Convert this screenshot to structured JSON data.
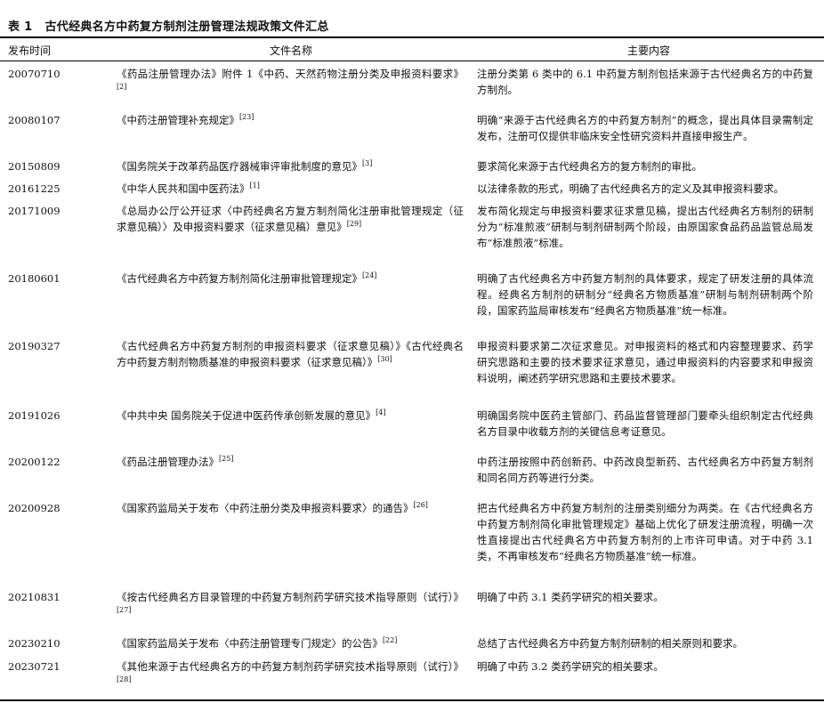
{
  "table": {
    "label": "表 1",
    "title": "古代经典名方中药复方制剂注册管理法规政策文件汇总",
    "headers": [
      "发布时间",
      "文件名称",
      "主要内容"
    ],
    "rows": [
      {
        "date": "20070710",
        "name": "《药品注册管理办法》附件 1《中药、天然药物注册分类及申报资料要求》",
        "ref": "[2]",
        "content": "注册分类第 6 类中的 6.1 中药复方制剂包括来源于古代经典名方的中药复方制剂。"
      },
      {
        "date": "20080107",
        "name": "《中药注册管理补充规定》",
        "ref": "[23]",
        "content": "明确“来源于古代经典名方的中药复方制剂”的概念，提出具体目录需制定发布，注册可仅提供非临床安全性研究资料并直接申报生产。"
      },
      {
        "date": "20150809",
        "name": "《国务院关于改革药品医疗器械审评审批制度的意见》",
        "ref": "[3]",
        "content": "要求简化来源于古代经典名方的复方制剂的审批。"
      },
      {
        "date": "20161225",
        "name": "《中华人民共和国中医药法》",
        "ref": "[1]",
        "content": "以法律条款的形式，明确了古代经典名方的定义及其申报资料要求。"
      },
      {
        "date": "20171009",
        "name": "《总局办公厅公开征求〈中药经典名方复方制剂简化注册审批管理规定（征求意见稿）〉及申报资料要求（征求意见稿）意见》",
        "ref": "[29]",
        "content": "发布简化规定与申报资料要求征求意见稿，提出古代经典名方制剂的研制分为“标准煎液”研制与制剂研制两个阶段，由原国家食品药品监管总局发布“标准煎液”标准。"
      },
      {
        "date": "20180601",
        "name": "《古代经典名方中药复方制剂简化注册审批管理规定》",
        "ref": "[24]",
        "content": "明确了古代经典名方中药复方制剂的具体要求，规定了研发注册的具体流程。经典名方制剂的研制分“经典名方物质基准”研制与制剂研制两个阶段，国家药监局审核发布“经典名方物质基准”统一标准。"
      },
      {
        "date": "20190327",
        "name": "《古代经典名方中药复方制剂的申报资料要求（征求意见稿）》《古代经典名方中药复方制剂物质基准的申报资料要求（征求意见稿）》",
        "ref": "[30]",
        "content": "申报资料要求第二次征求意见。对申报资料的格式和内容整理要求、药学研究思路和主要的技术要求征求意见，通过申报资料的内容要求和申报资料说明，阐述药学研究思路和主要技术要求。"
      },
      {
        "date": "20191026",
        "name": "《中共中央 国务院关于促进中医药传承创新发展的意见》",
        "ref": "[4]",
        "content": "明确国务院中医药主管部门、药品监督管理部门要牵头组织制定古代经典名方目录中收载方剂的关键信息考证意见。"
      },
      {
        "date": "20200122",
        "name": "《药品注册管理办法》",
        "ref": "[25]",
        "content": "中药注册按照中药创新药、中药改良型新药、古代经典名方中药复方制剂和同名同方药等进行分类。"
      },
      {
        "date": "20200928",
        "name": "《国家药监局关于发布〈中药注册分类及申报资料要求〉的通告》",
        "ref": "[26]",
        "content": "把古代经典名方中药复方制剂的注册类别细分为两类。在《古代经典名方中药复方制剂简化审批管理规定》基础上优化了研发注册流程，明确一次性直接提出古代经典名方中药复方制剂的上市许可申请。对于中药 3.1 类，不再审核发布“经典名方物质基准”统一标准。"
      },
      {
        "date": "20210831",
        "name": "《按古代经典名方目录管理的中药复方制剂药学研究技术指导原则（试行）》",
        "ref": "[27]",
        "content": "明确了中药 3.1 类药学研究的相关要求。"
      },
      {
        "date": "20230210",
        "name": "《国家药监局关于发布〈中药注册管理专门规定〉的公告》",
        "ref": "[22]",
        "content": "总结了古代经典名方中药复方制剂研制的相关原则和要求。"
      },
      {
        "date": "20230721",
        "name": "《其他来源于古代经典名方的中药复方制剂药学研究技术指导原则（试行）》",
        "ref": "[28]",
        "content": "明确了中药 3.2 类药学研究的相关要求。"
      }
    ]
  }
}
